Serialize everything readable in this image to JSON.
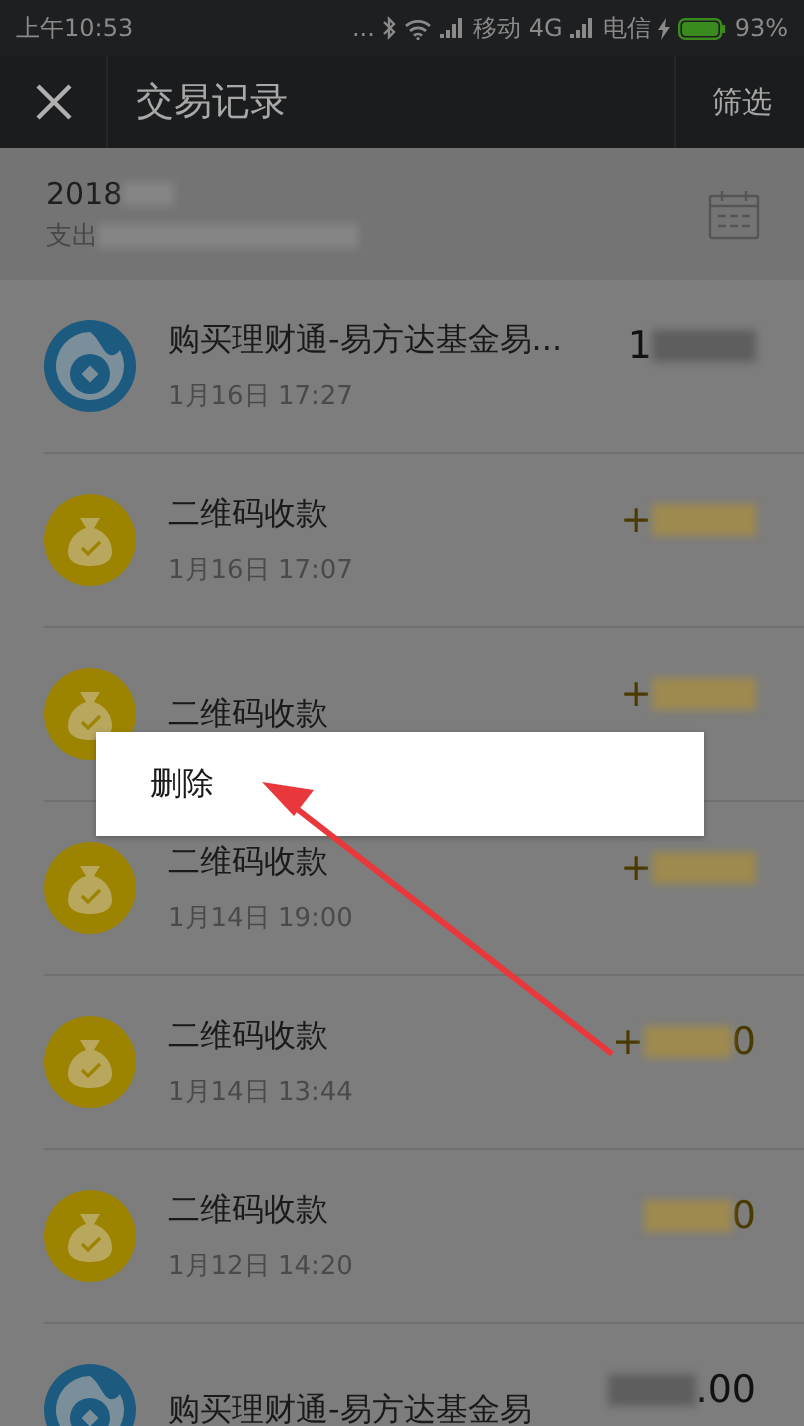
{
  "status_bar": {
    "time": "上午10:53",
    "dots": "...",
    "carrier_1": "移动",
    "network_1": "4G",
    "carrier_2": "电信",
    "battery": "93%"
  },
  "nav": {
    "title": "交易记录",
    "action": "筛选"
  },
  "month": {
    "title": "2018",
    "summary": "支出"
  },
  "transactions": [
    {
      "kind": "fund",
      "title": "购买理财通-易方达基金易...",
      "time": "1月16日 17:27",
      "amount": "1"
    },
    {
      "kind": "qr",
      "title": "二维码收款",
      "time": "1月16日 17:07",
      "amount": "+"
    },
    {
      "kind": "qr",
      "title": "二维码收款",
      "amount": "+"
    },
    {
      "kind": "qr",
      "title": "二维码收款",
      "time": "1月14日 19:00",
      "amount": "+"
    },
    {
      "kind": "qr",
      "title": "二维码收款",
      "time": "1月14日 13:44",
      "amount": "+",
      "amount_tail": "0"
    },
    {
      "kind": "qr",
      "title": "二维码收款",
      "time": "1月12日 14:20",
      "amount_tail": "0"
    },
    {
      "kind": "fund",
      "title": "购买理财通-易方达基金易",
      "amount_tail": ".00"
    }
  ],
  "context_menu": {
    "items": [
      "删除"
    ]
  }
}
